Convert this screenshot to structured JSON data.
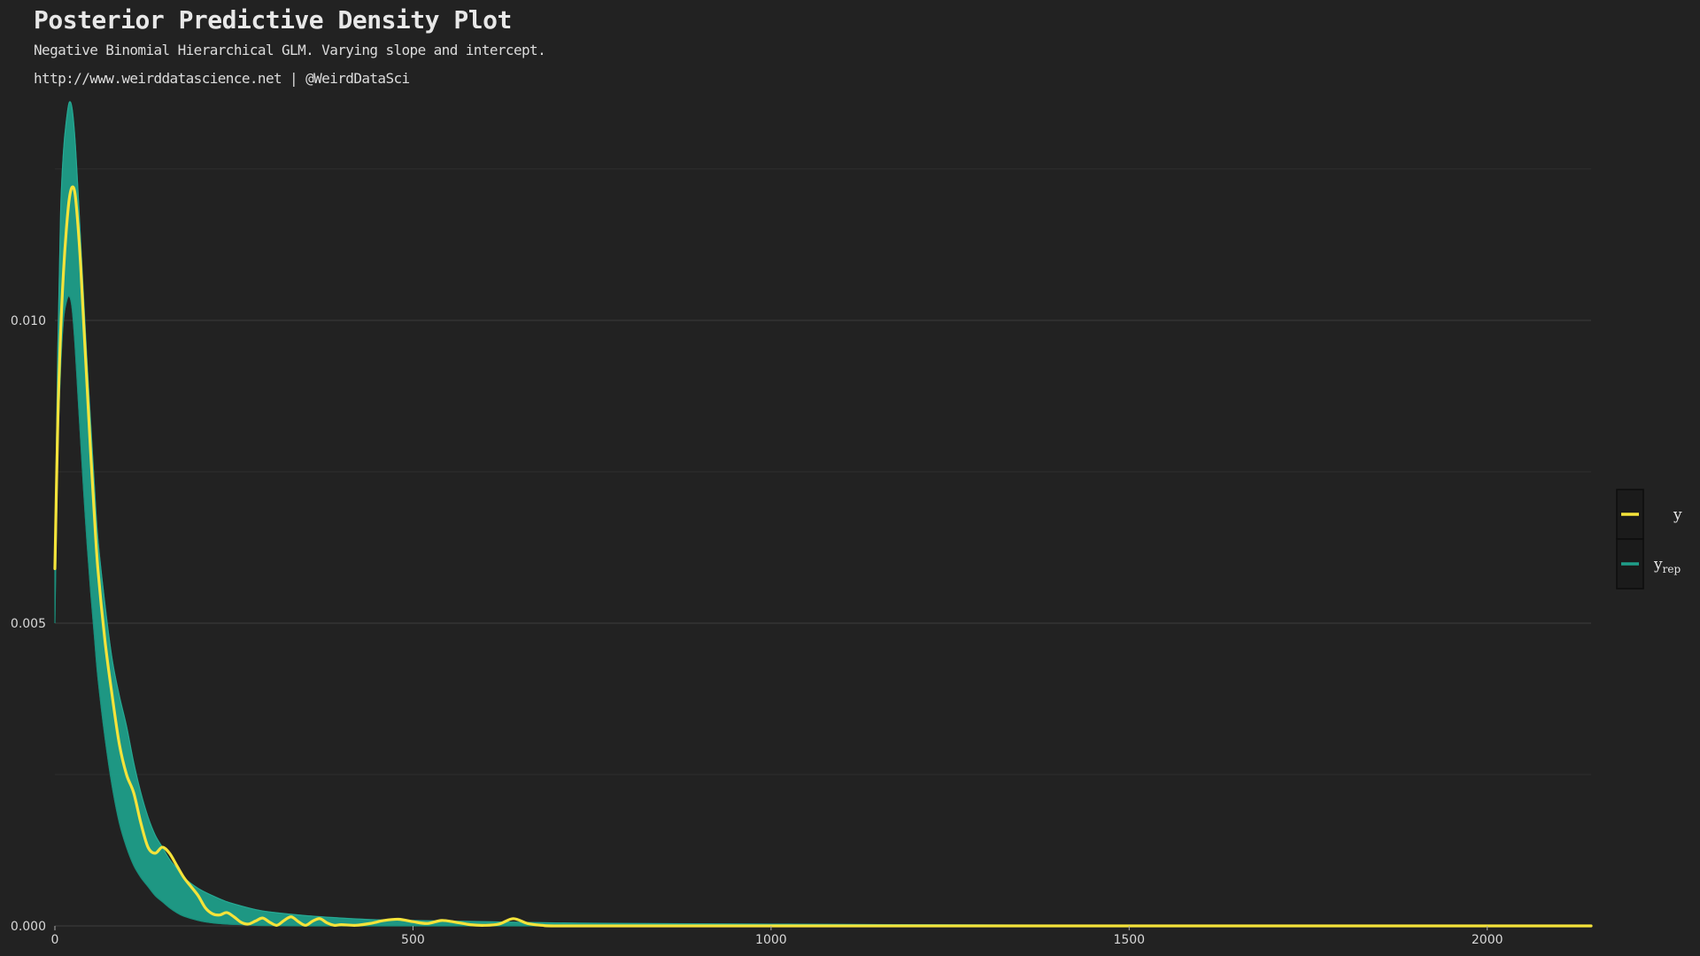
{
  "chart_data": {
    "type": "area",
    "title": "Posterior Predictive Density Plot",
    "subtitle": "Negative Binomial Hierarchical GLM. Varying slope and intercept.",
    "caption": "http://www.weirddatascience.net | @WeirdDataSci",
    "xlabel": "",
    "ylabel": "",
    "xlim": [
      0,
      2145
    ],
    "ylim": [
      0,
      0.0138
    ],
    "x_ticks": [
      0,
      500,
      1000,
      1500,
      2000
    ],
    "x_tick_labels": [
      "0",
      "500",
      "1000",
      "1500",
      "2000"
    ],
    "y_ticks": [
      0.0,
      0.005,
      0.01
    ],
    "y_tick_labels": [
      "0.000",
      "0.005",
      "0.010"
    ],
    "y_minor_gridlines": [
      0.0025,
      0.0075,
      0.0125
    ],
    "grid": true,
    "legend_position": "right",
    "series": [
      {
        "name": "y",
        "kind": "line",
        "color": "#f5e33a",
        "x": [
          0,
          4,
          8,
          12,
          16,
          20,
          24,
          28,
          32,
          36,
          40,
          45,
          50,
          55,
          60,
          70,
          80,
          90,
          100,
          110,
          120,
          130,
          140,
          150,
          160,
          170,
          180,
          190,
          200,
          210,
          220,
          230,
          240,
          250,
          260,
          270,
          280,
          290,
          300,
          310,
          320,
          330,
          340,
          350,
          360,
          370,
          380,
          390,
          400,
          420,
          440,
          460,
          480,
          500,
          520,
          540,
          560,
          580,
          600,
          620,
          640,
          660,
          680,
          700,
          800,
          1000,
          1200,
          1500,
          1800,
          2145
        ],
        "y": [
          0.0059,
          0.0083,
          0.0098,
          0.0108,
          0.0115,
          0.012,
          0.0122,
          0.0121,
          0.0116,
          0.0109,
          0.01,
          0.0089,
          0.0078,
          0.0068,
          0.0059,
          0.0047,
          0.0038,
          0.003,
          0.0025,
          0.0022,
          0.0017,
          0.0013,
          0.0012,
          0.0013,
          0.0012,
          0.001,
          0.0008,
          0.00065,
          0.0005,
          0.0003,
          0.0002,
          0.00018,
          0.00022,
          0.00015,
          6e-05,
          3e-05,
          8e-05,
          0.00013,
          6e-05,
          1e-05,
          9e-05,
          0.00015,
          7e-05,
          1e-05,
          8e-05,
          0.00012,
          5e-05,
          1e-05,
          2e-05,
          1e-05,
          4e-05,
          9e-05,
          0.00011,
          7e-05,
          4e-05,
          9e-05,
          6e-05,
          2e-05,
          1e-05,
          3e-05,
          0.00012,
          4e-05,
          1e-05,
          0.0,
          0.0,
          0.0,
          0.0,
          0.0,
          0.0,
          0.0
        ]
      },
      {
        "name": "y_rep",
        "kind": "band",
        "color": "#1f9e89",
        "x": [
          0,
          4,
          8,
          12,
          16,
          20,
          24,
          28,
          32,
          36,
          40,
          45,
          50,
          55,
          60,
          70,
          80,
          90,
          100,
          110,
          120,
          130,
          140,
          150,
          160,
          170,
          180,
          200,
          220,
          240,
          260,
          280,
          300,
          350,
          400,
          450,
          500,
          600,
          700,
          800,
          1000,
          1200,
          1500,
          1800,
          2145
        ],
        "y_low": [
          0.005,
          0.0078,
          0.0092,
          0.01,
          0.0103,
          0.0104,
          0.0102,
          0.0096,
          0.0088,
          0.008,
          0.0072,
          0.0063,
          0.0055,
          0.0048,
          0.0041,
          0.0031,
          0.0023,
          0.0017,
          0.0013,
          0.001,
          0.0008,
          0.00065,
          0.0005,
          0.0004,
          0.0003,
          0.00022,
          0.00016,
          9e-05,
          5e-05,
          3e-05,
          2e-05,
          1e-05,
          5e-06,
          0.0,
          0.0,
          0.0,
          0.0,
          0.0,
          0.0,
          0.0,
          0.0,
          0.0,
          0.0,
          0.0,
          0.0
        ],
        "y_high": [
          0.006,
          0.0095,
          0.0118,
          0.0128,
          0.0133,
          0.0136,
          0.0135,
          0.013,
          0.0122,
          0.0113,
          0.0104,
          0.0093,
          0.0083,
          0.0073,
          0.0064,
          0.0053,
          0.0044,
          0.0038,
          0.0033,
          0.0027,
          0.0022,
          0.0018,
          0.0015,
          0.0013,
          0.0011,
          0.00095,
          0.0008,
          0.00062,
          0.0005,
          0.0004,
          0.00033,
          0.00027,
          0.00023,
          0.00017,
          0.00013,
          0.0001,
          9e-05,
          7e-05,
          5e-05,
          4e-05,
          3e-05,
          2e-05,
          1e-05,
          8e-06,
          5e-06
        ]
      }
    ],
    "legend": [
      {
        "label": "y",
        "color": "#f5e33a"
      },
      {
        "label": "y",
        "subscript": "rep",
        "color": "#1f9e89"
      }
    ]
  }
}
